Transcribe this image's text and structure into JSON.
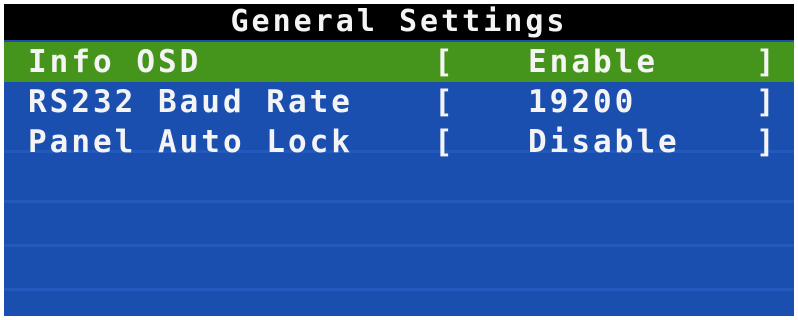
{
  "title": "General Settings",
  "bracket_open": "[",
  "bracket_close": "]",
  "items": [
    {
      "label": "Info OSD",
      "value": "Enable",
      "selected": true
    },
    {
      "label": "RS232 Baud Rate",
      "value": "19200",
      "selected": false
    },
    {
      "label": "Panel Auto Lock",
      "value": "Disable",
      "selected": false
    }
  ],
  "colors": {
    "background": "#1a4fb0",
    "title_bar": "#000000",
    "selected_row": "#45951c",
    "text": "#f4f4f4"
  }
}
